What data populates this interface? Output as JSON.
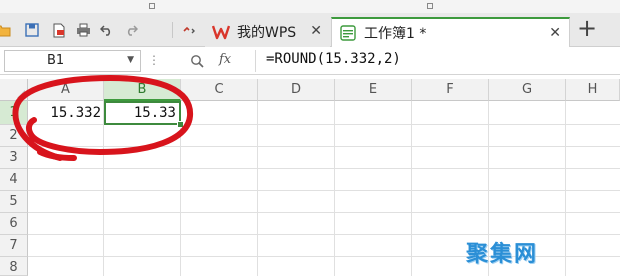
{
  "tabs": [
    {
      "label": "我的WPS",
      "active": false
    },
    {
      "label": "工作簿1 *",
      "active": true
    }
  ],
  "formula_bar": {
    "name_box": "B1",
    "fx_label": "fx",
    "formula": "=ROUND(15.332,2)"
  },
  "sheet": {
    "columns": [
      "A",
      "B",
      "C",
      "D",
      "E",
      "F",
      "G",
      "H"
    ],
    "rows": [
      "1",
      "2",
      "3",
      "4",
      "5",
      "6",
      "7",
      "8"
    ],
    "selected_cell": "B1",
    "cells": {
      "A1": "15.332",
      "B1": "15.33"
    }
  },
  "watermark": "聚集网",
  "colors": {
    "accent": "#3d9a3d",
    "annotation": "#d8141c",
    "wps_red": "#d9362b",
    "watermark": "#2b8fd6"
  },
  "icons": [
    "folder-icon",
    "save-icon",
    "export-pdf-icon",
    "print-icon",
    "undo-icon",
    "redo-icon",
    "customize-icon",
    "wps-logo-icon",
    "spreadsheet-icon",
    "zoom-icon"
  ]
}
